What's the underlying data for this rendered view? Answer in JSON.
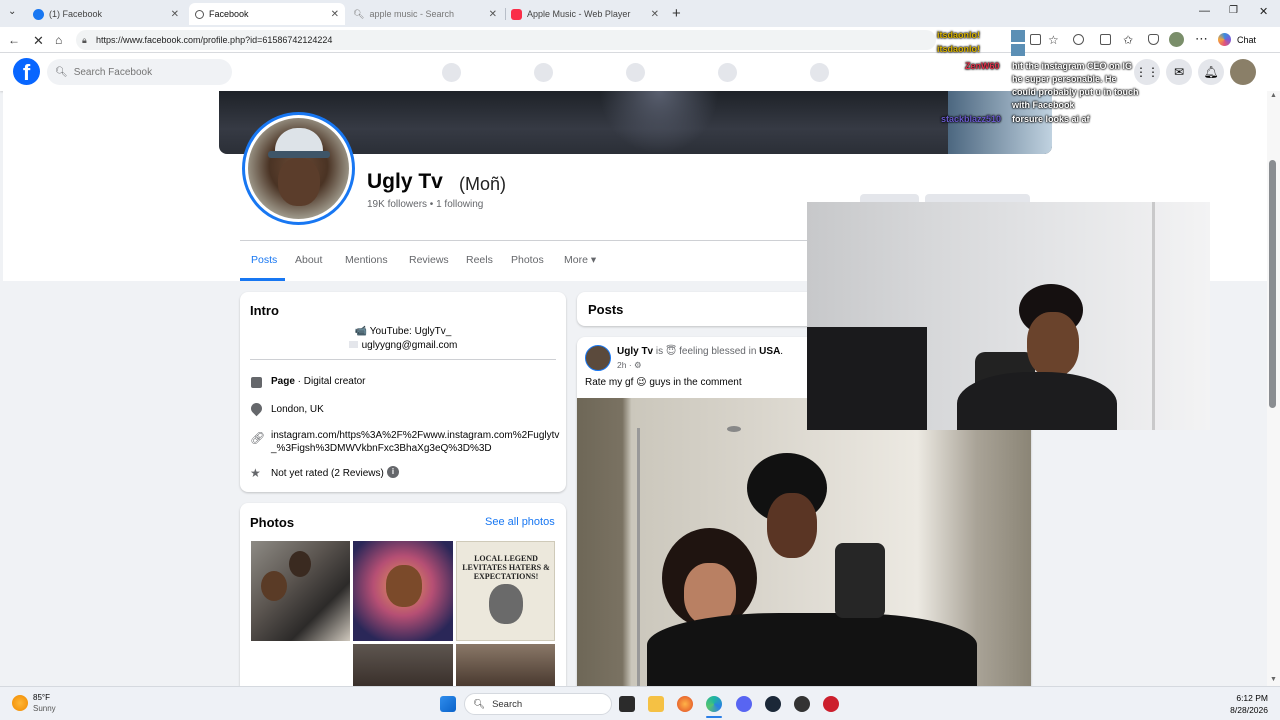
{
  "browser": {
    "tabs": [
      {
        "title": "(1) Facebook"
      },
      {
        "title": "Facebook"
      },
      {
        "title": "apple music - Search"
      },
      {
        "title": "Apple Music - Web Player"
      }
    ],
    "url": "https://www.facebook.com/profile.php?id=61586742124224",
    "chat_label": "Chat"
  },
  "fb": {
    "search_placeholder": "Search Facebook",
    "brand_color": "#1877f2"
  },
  "profile": {
    "name": "Ugly Tv",
    "alt_name": "(Moñ)",
    "stats": "19K followers • 1 following",
    "tabs": [
      "Posts",
      "About",
      "Mentions",
      "Reviews",
      "Reels",
      "Photos",
      "More ▾"
    ]
  },
  "intro": {
    "title": "Intro",
    "youtube": "📹 YouTube: UglyTv_",
    "email": "uglyygng@gmail.com",
    "page_label": "Page",
    "page_type": " · Digital creator",
    "location": "London, UK",
    "link_line1": "instagram.com/https%3A%2F%2Fwww.instagram.com%2Fuglytv",
    "link_line2": "_%3Figsh%3DMWVkbnFxc3BhaXg3eQ%3D%3D",
    "rating": "Not yet rated (2 Reviews)"
  },
  "photos": {
    "title": "Photos",
    "see_all": "See all photos",
    "newspaper_headline": "LOCAL LEGEND LEVITATES HATERS & EXPECTATIONS!"
  },
  "posts": {
    "title": "Posts",
    "author": "Ugly Tv",
    "is_text": " is 😇 feeling blessed in ",
    "location": "USA",
    "time": "2h · ⚙",
    "text": "Rate my gf 😉 guys in the comment"
  },
  "chat_overlay": {
    "lines": [
      {
        "user": "itsdaonlo!",
        "msg": ""
      },
      {
        "user": "itsdaonlo!",
        "msg": ""
      },
      {
        "user": "ZenW60",
        "msg": "hit the instagram CEO on IG"
      },
      {
        "user": "",
        "msg": "he super personable. He"
      },
      {
        "user": "",
        "msg": "could probably put u in touch"
      },
      {
        "user": "",
        "msg": "with Facebook"
      },
      {
        "user": "stackblazz510",
        "msg": "forsure looks ai af"
      }
    ]
  },
  "taskbar": {
    "weather_temp": "85°F",
    "weather_desc": "Sunny",
    "search_label": "Search",
    "time": "6:12 PM",
    "date": "8/28/2026"
  }
}
